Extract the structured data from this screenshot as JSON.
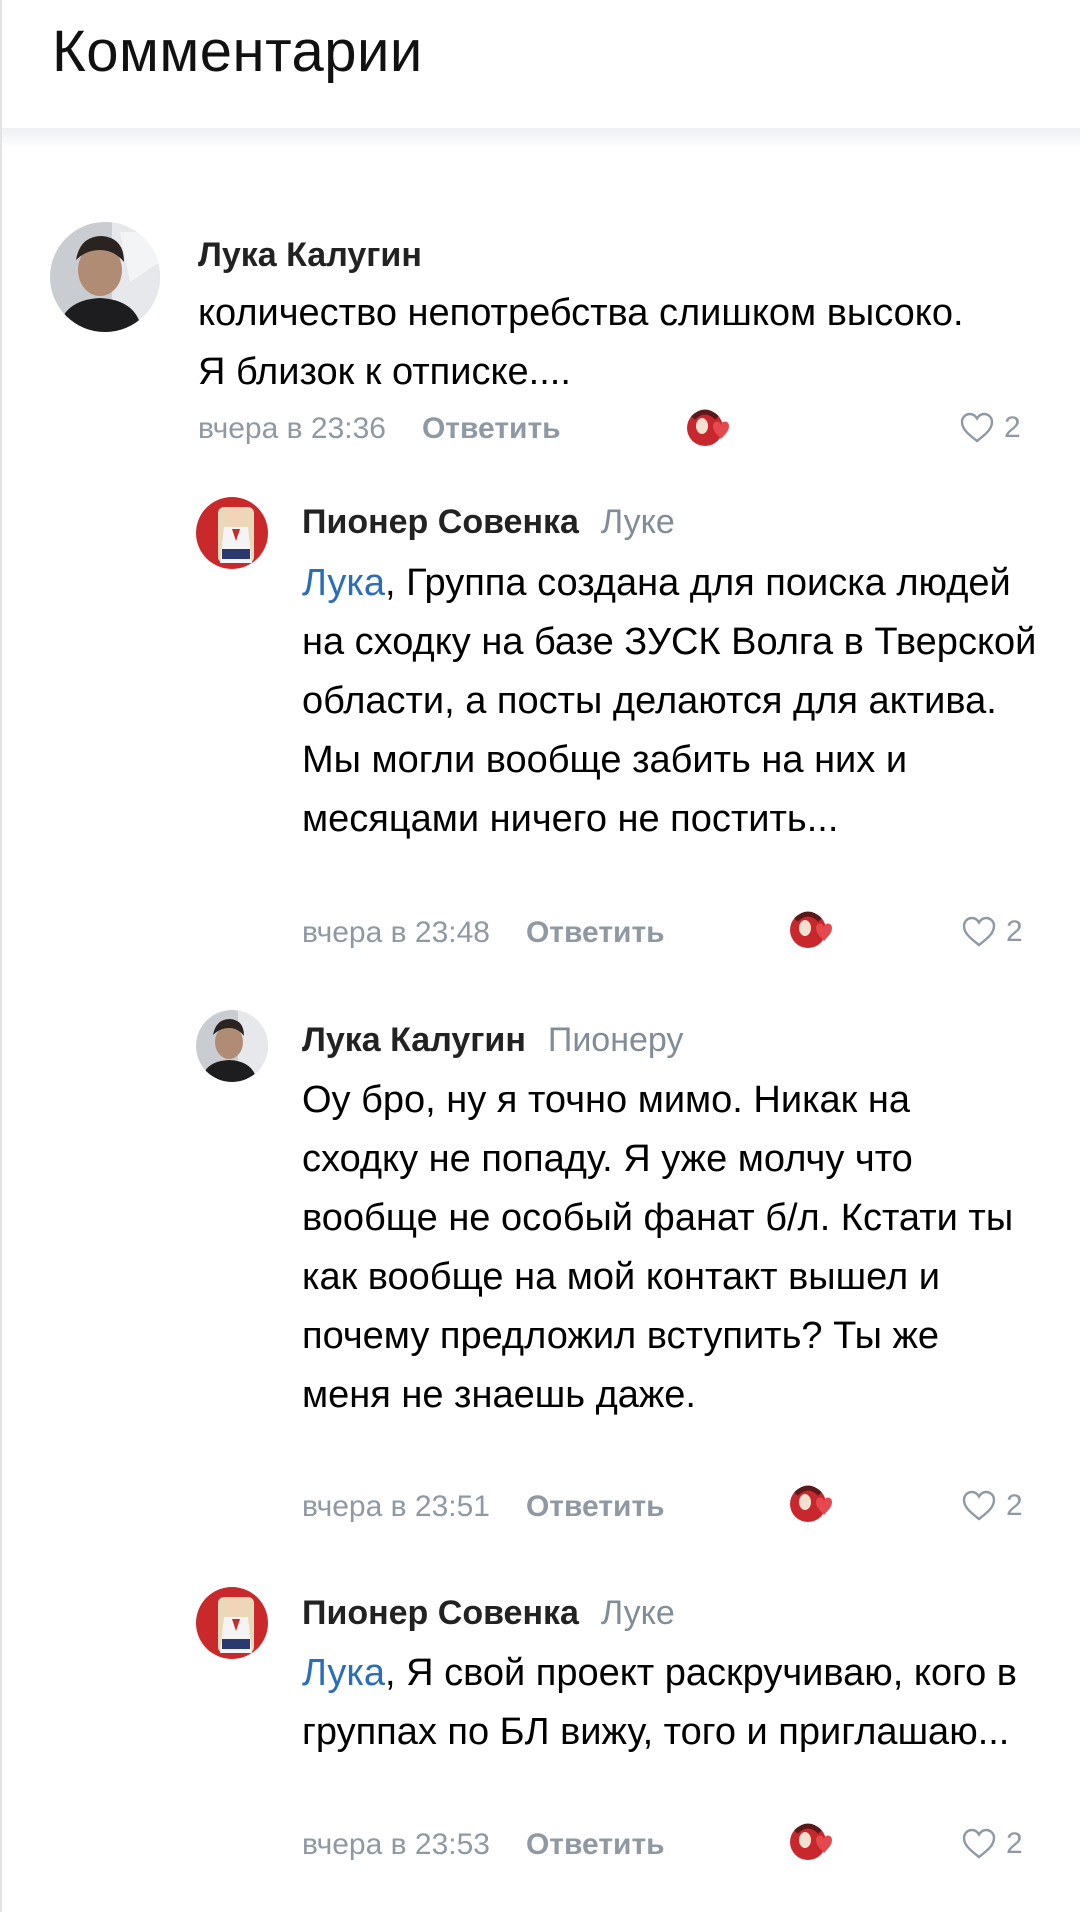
{
  "page": {
    "title": "Комментарии"
  },
  "comments": [
    {
      "author": "Лука Калугин",
      "reply_to": "",
      "mention": "",
      "text": "количество непотребства слишком высоко. Я близок к отписке....",
      "time": "вчера в 23:36",
      "reply_label": "Ответить",
      "likes": "2"
    },
    {
      "author": "Пионер Совенка",
      "reply_to": "Луке",
      "mention": "Лука",
      "text": ", Группа создана для поиска людей на сходку на базе ЗУСК Волга в Тверской области, а посты делаются для актива. Мы могли вообще забить на них и месяцами ничего не постить...",
      "time": "вчера в 23:48",
      "reply_label": "Ответить",
      "likes": "2"
    },
    {
      "author": "Лука Калугин",
      "reply_to": "Пионеру",
      "mention": "",
      "text": "Оу бро, ну я точно мимо. Никак на сходку не попаду. Я уже молчу что вообще не особый фанат б/л. Кстати ты как вообще на мой контакт вышел и почему предложил вступить? Ты же меня не знаешь даже.",
      "time": "вчера в 23:51",
      "reply_label": "Ответить",
      "likes": "2"
    },
    {
      "author": "Пионер Совенка",
      "reply_to": "Луке",
      "mention": "Лука",
      "text": ", Я свой проект раскручиваю, кого в группах по БЛ вижу, того и приглашаю...",
      "time": "вчера в 23:53",
      "reply_label": "Ответить",
      "likes": "2"
    }
  ],
  "colors": {
    "link": "#2a6eb8",
    "meta": "#8f99a4",
    "sticker_red": "#c8282d",
    "heart": "#e5484d"
  }
}
